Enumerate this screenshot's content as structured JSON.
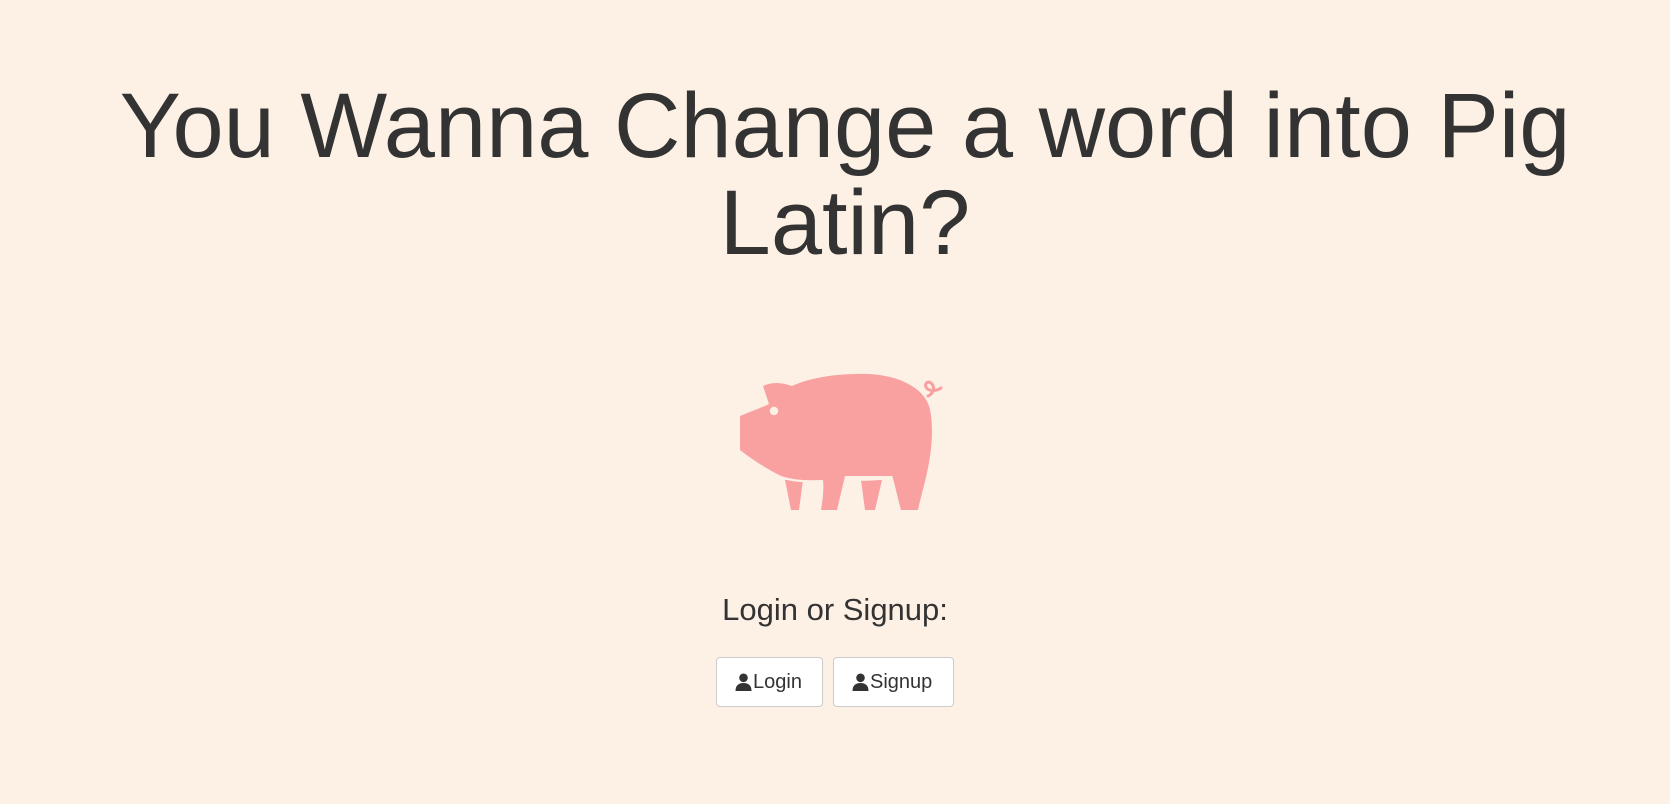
{
  "header": {
    "title": "You Wanna Change a word into Pig Latin?"
  },
  "hero": {
    "icon": "pig-icon",
    "icon_color": "#f9a1a1"
  },
  "auth": {
    "prompt": "Login or Signup:",
    "login_label": "Login",
    "signup_label": "Signup",
    "button_icon": "user-icon"
  },
  "colors": {
    "background": "#fdf1e5",
    "text": "#333333"
  }
}
